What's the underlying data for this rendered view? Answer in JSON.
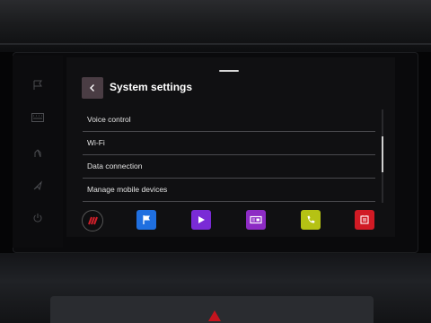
{
  "header": {
    "title": "System settings"
  },
  "menu": {
    "items": [
      {
        "label": "Voice control"
      },
      {
        "label": "Wi-Fi"
      },
      {
        "label": "Data connection"
      },
      {
        "label": "Manage mobile devices"
      }
    ]
  },
  "dock": {
    "apps": [
      {
        "icon": "brand-menu-icon",
        "color": "#c0141e"
      },
      {
        "icon": "navigation-flag-icon",
        "color": "#1f6fe0"
      },
      {
        "icon": "media-play-icon",
        "color": "#7a2bd6"
      },
      {
        "icon": "radio-icon",
        "color": "#8d2bc4"
      },
      {
        "icon": "phone-icon",
        "color": "#b5c214"
      },
      {
        "icon": "vehicle-info-icon",
        "color": "#d11a24"
      }
    ]
  },
  "hardware_buttons": [
    "flag-icon",
    "keyboard-icon",
    "hand-icon",
    "navigation-arrow-icon",
    "power-icon"
  ]
}
